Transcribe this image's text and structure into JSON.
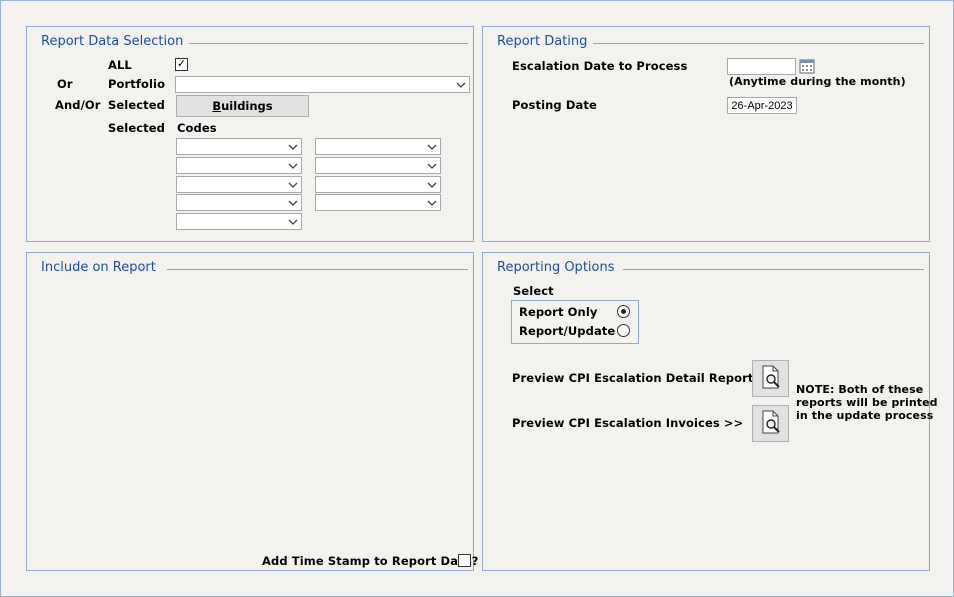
{
  "report_data_selection": {
    "title": "Report Data Selection",
    "all_label": "ALL",
    "all_checked": true,
    "or_label": "Or",
    "portfolio_label": "Portfolio",
    "portfolio_value": "",
    "andor_label": "And/Or",
    "selected_label_1": "Selected",
    "buildings_button_prefix": "",
    "buildings_button_underline": "B",
    "buildings_button_rest": "uildings",
    "selected_label_2": "Selected",
    "codes_label": "Codes"
  },
  "report_dating": {
    "title": "Report Dating",
    "escalation_label": "Escalation Date to Process",
    "escalation_value": "",
    "escalation_hint": "(Anytime during the month)",
    "posting_label": "Posting Date",
    "posting_value": "26-Apr-2023"
  },
  "include_on_report": {
    "title": "Include on Report",
    "timestamp_label": "Add Time Stamp to Report Date?",
    "timestamp_checked": false
  },
  "reporting_options": {
    "title": "Reporting Options",
    "select_label": "Select",
    "report_only_label": "Report Only",
    "report_update_label": "Report/Update",
    "selected_option": "report_only",
    "preview_detail_label": "Preview CPI Escalation Detail Report >>",
    "preview_invoices_label": "Preview CPI Escalation Invoices >>",
    "note_line1": "NOTE:  Both of these",
    "note_line2": "reports will be printed",
    "note_line3": "in the update process"
  }
}
